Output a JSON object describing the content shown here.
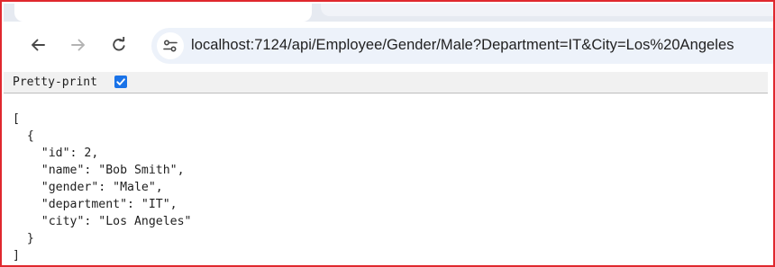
{
  "browser": {
    "address_bar": {
      "url": "localhost:7124/api/Employee/Gender/Male?Department=IT&City=Los%20Angeles"
    },
    "icons": {
      "back": "arrow-left-icon",
      "forward": "arrow-right-icon",
      "reload": "reload-icon",
      "site_info": "tune-icon"
    }
  },
  "viewer": {
    "pretty_print_label": "Pretty-print",
    "pretty_print_checked": true,
    "json_text": "[\n  {\n    \"id\": 2,\n    \"name\": \"Bob Smith\",\n    \"gender\": \"Male\",\n    \"department\": \"IT\",\n    \"city\": \"Los Angeles\"\n  }\n]"
  },
  "colors": {
    "frame_border": "#e0282e",
    "checkbox_accent": "#1a73e8",
    "omnibox_background": "#edf2fa"
  }
}
